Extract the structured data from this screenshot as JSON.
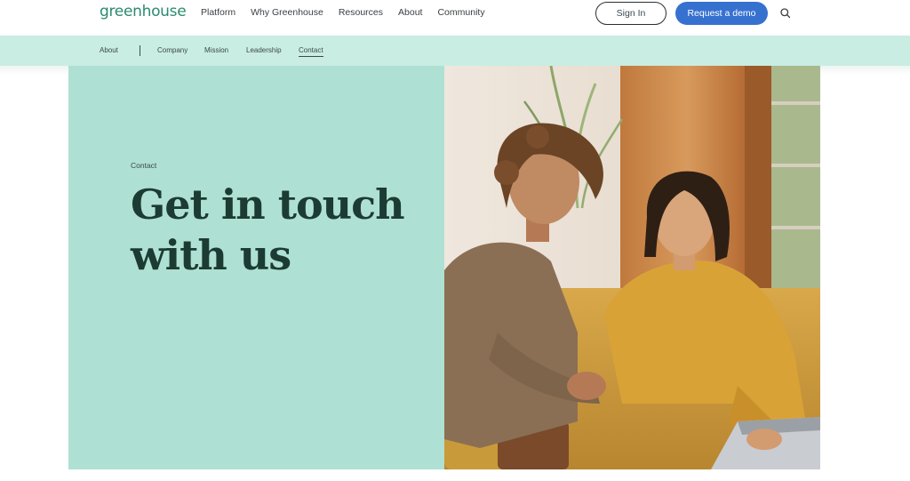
{
  "brand": {
    "logo_text": "greenhouse"
  },
  "nav": {
    "links": [
      "Platform",
      "Why Greenhouse",
      "Resources",
      "About",
      "Community"
    ],
    "sign_in": "Sign In",
    "request_demo": "Request a demo"
  },
  "subnav": {
    "section": "About",
    "items": [
      "Company",
      "Mission",
      "Leadership",
      "Contact"
    ],
    "active": "Contact"
  },
  "hero": {
    "eyebrow": "Contact",
    "headline": "Get in touch with us"
  },
  "colors": {
    "brand_green": "#2b8a6e",
    "demo_blue": "#3771d0",
    "subnav_bg": "#c9ede3",
    "hero_bg": "#aee0d3",
    "headline": "#1c3b32"
  },
  "icons": {
    "search": "search-icon"
  }
}
